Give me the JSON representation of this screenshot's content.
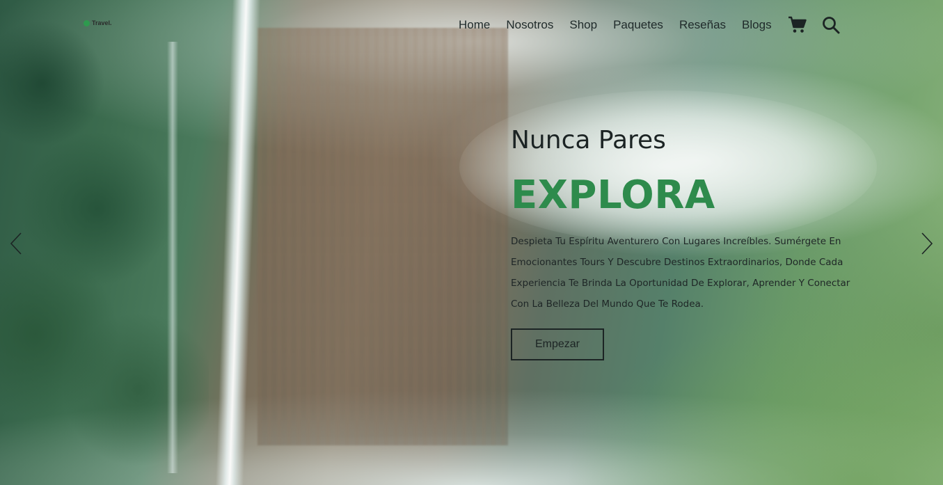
{
  "brand": {
    "logo_text": "Travel."
  },
  "nav": {
    "items": [
      {
        "label": "Home"
      },
      {
        "label": "Nosotros"
      },
      {
        "label": "Shop"
      },
      {
        "label": "Paquetes"
      },
      {
        "label": "Reseñas"
      },
      {
        "label": "Blogs"
      }
    ],
    "cart_icon": "shopping-cart-icon",
    "search_icon": "search-icon"
  },
  "hero": {
    "subtitle": "Nunca Pares",
    "title": "EXPLORA",
    "description": "Despieta Tu Espíritu Aventurero Con Lugares Increíbles. Sumérgete En Emocionantes Tours Y Descubre Destinos Extraordinarios, Donde Cada Experiencia Te Brinda La Oportunidad De Explorar, Aprender Y Conectar Con La Belleza Del Mundo Que Te Rodea.",
    "cta_label": "Empezar",
    "prev_icon": "chevron-left-icon",
    "next_icon": "chevron-right-icon"
  },
  "colors": {
    "accent": "#2e8b4c",
    "text": "#1c2424"
  }
}
